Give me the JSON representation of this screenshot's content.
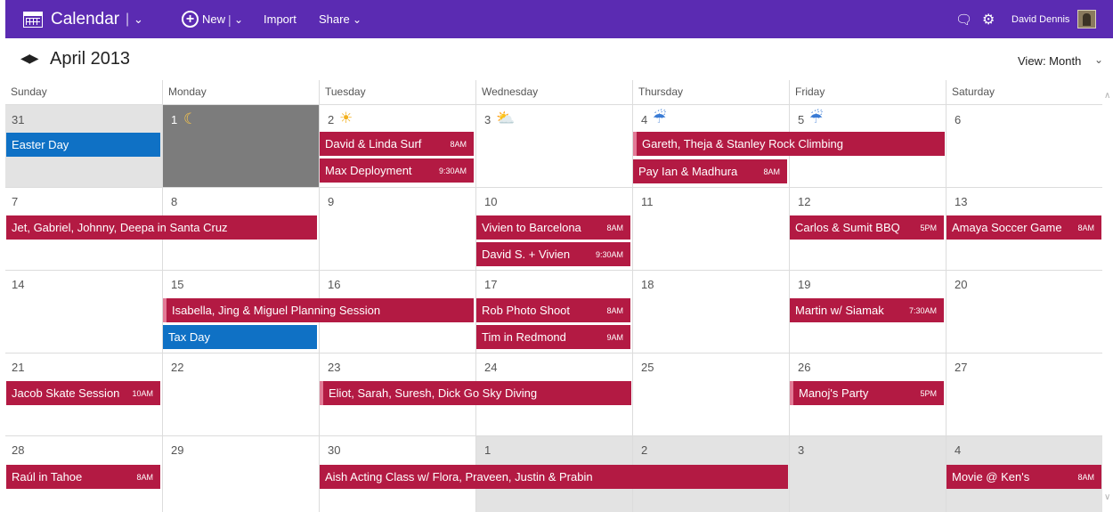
{
  "topbar": {
    "app_title": "Calendar",
    "new_label": "New",
    "import_label": "Import",
    "share_label": "Share",
    "user_name": "David Dennis",
    "bg_color": "#5b2bb2"
  },
  "nav": {
    "month_title": "April 2013",
    "view_label": "View: Month"
  },
  "weekdays": [
    "Sunday",
    "Monday",
    "Tuesday",
    "Wednesday",
    "Thursday",
    "Friday",
    "Saturday"
  ],
  "days": [
    "31",
    "1",
    "2",
    "3",
    "4",
    "5",
    "6",
    "7",
    "8",
    "9",
    "10",
    "11",
    "12",
    "13",
    "14",
    "15",
    "16",
    "17",
    "18",
    "19",
    "20",
    "21",
    "22",
    "23",
    "24",
    "25",
    "26",
    "27",
    "28",
    "29",
    "30",
    "1",
    "2",
    "3",
    "4"
  ],
  "events": [
    {
      "label": "Easter Day",
      "time": ""
    },
    {
      "label": "David & Linda Surf",
      "time": "8AM"
    },
    {
      "label": "Max Deployment",
      "time": "9:30AM"
    },
    {
      "label": "Gareth, Theja & Stanley Rock Climbing",
      "time": ""
    },
    {
      "label": "Pay Ian & Madhura",
      "time": "8AM"
    },
    {
      "label": "Jet, Gabriel, Johnny, Deepa in Santa Cruz",
      "time": ""
    },
    {
      "label": "Vivien to Barcelona",
      "time": "8AM"
    },
    {
      "label": "David S. + Vivien",
      "time": "9:30AM"
    },
    {
      "label": "Carlos & Sumit BBQ",
      "time": "5PM"
    },
    {
      "label": "Amaya Soccer Game",
      "time": "8AM"
    },
    {
      "label": "Isabella, Jing & Miguel Planning Session",
      "time": ""
    },
    {
      "label": "Tax Day",
      "time": ""
    },
    {
      "label": "Rob Photo Shoot",
      "time": "8AM"
    },
    {
      "label": "Tim in Redmond",
      "time": "9AM"
    },
    {
      "label": "Martin w/ Siamak",
      "time": "7:30AM"
    },
    {
      "label": "Jacob Skate Session",
      "time": "10AM"
    },
    {
      "label": "Eliot, Sarah, Suresh, Dick Go Sky Diving",
      "time": ""
    },
    {
      "label": "Manoj's Party",
      "time": "5PM"
    },
    {
      "label": "Raúl in Tahoe",
      "time": "8AM"
    },
    {
      "label": "Aish Acting Class w/ Flora, Praveen, Justin & Prabin",
      "time": ""
    },
    {
      "label": "Movie @ Ken's",
      "time": "8AM"
    }
  ],
  "colors": {
    "event": "#b31a43",
    "holiday": "#0f71c5",
    "today": "#7c7c7c"
  }
}
